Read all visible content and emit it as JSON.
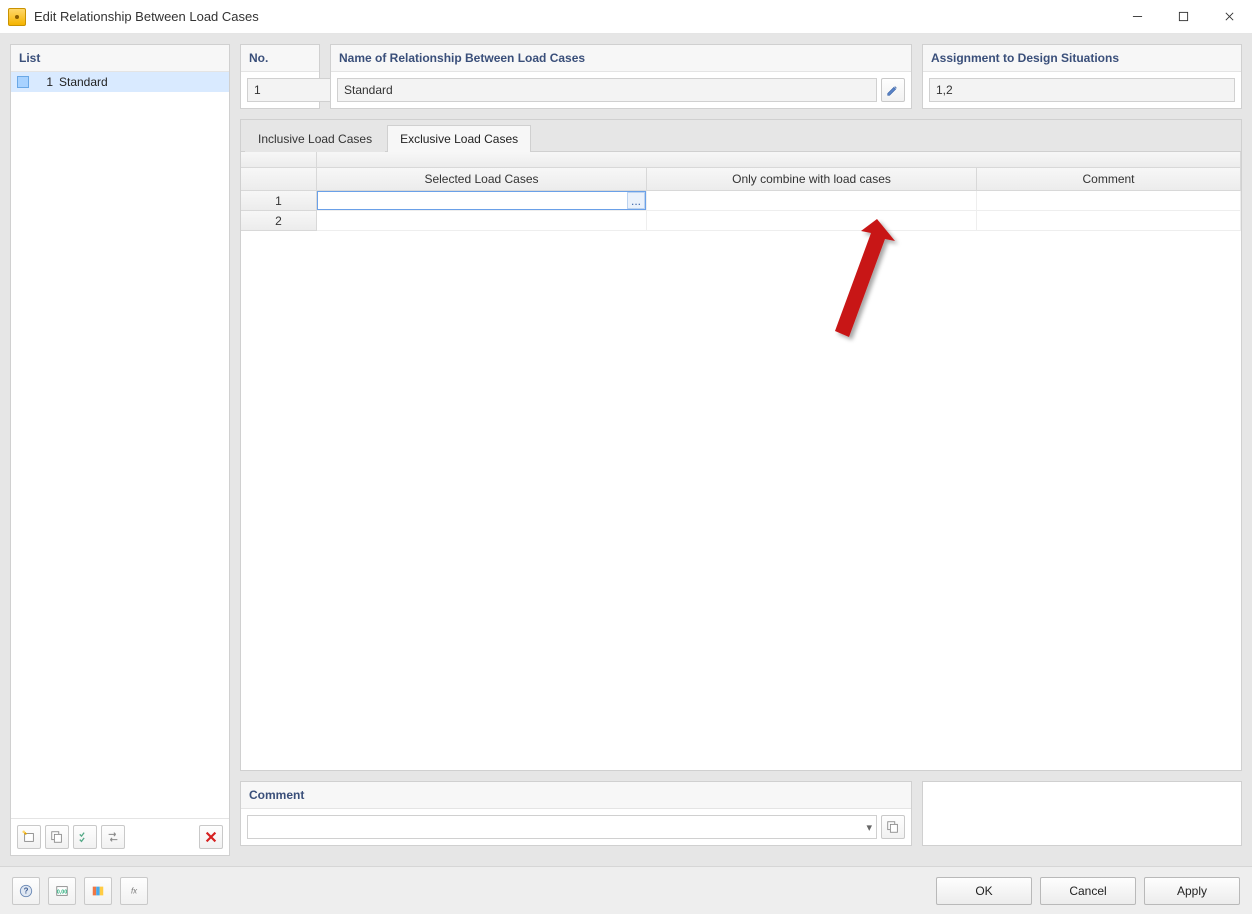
{
  "window": {
    "title": "Edit Relationship Between Load Cases"
  },
  "list": {
    "header": "List",
    "items": [
      {
        "num": "1",
        "label": "Standard",
        "selected": true
      }
    ],
    "toolbar": {
      "new": "New",
      "copy": "Copy",
      "check": "Check",
      "swap": "Swap",
      "delete": "Delete"
    }
  },
  "fields": {
    "no_header": "No.",
    "no_value": "1",
    "name_header": "Name of Relationship Between Load Cases",
    "name_value": "Standard",
    "assign_header": "Assignment to Design Situations",
    "assign_value": "1,2"
  },
  "tabs": {
    "inclusive": "Inclusive Load Cases",
    "exclusive": "Exclusive Load Cases",
    "active": "exclusive"
  },
  "grid": {
    "columns": {
      "selected": "Selected Load Cases",
      "combine": "Only combine with load cases",
      "comment": "Comment"
    },
    "rows": [
      {
        "n": "1",
        "selected": "",
        "combine": "",
        "comment": "",
        "active": true
      },
      {
        "n": "2",
        "selected": "",
        "combine": "",
        "comment": ""
      }
    ],
    "ellipsis": "..."
  },
  "comment": {
    "header": "Comment",
    "value": ""
  },
  "footer": {
    "help": "Help",
    "units": "Units",
    "colors": "Colors",
    "fx": "fx",
    "ok": "OK",
    "cancel": "Cancel",
    "apply": "Apply"
  }
}
